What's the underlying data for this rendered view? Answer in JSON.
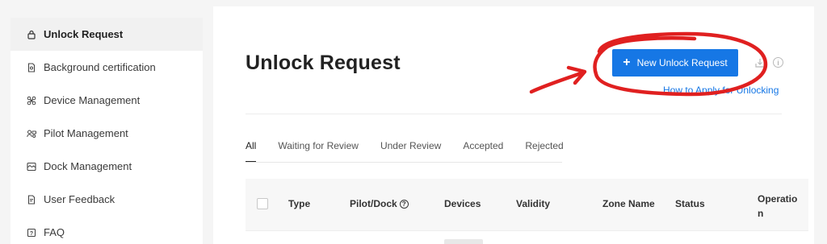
{
  "sidebar": {
    "items": [
      {
        "label": "Unlock Request",
        "icon": "lock-icon",
        "active": true
      },
      {
        "label": "Background certification",
        "icon": "document-icon",
        "active": false
      },
      {
        "label": "Device Management",
        "icon": "drone-icon",
        "active": false
      },
      {
        "label": "Pilot Management",
        "icon": "pilot-icon",
        "active": false
      },
      {
        "label": "Dock Management",
        "icon": "dock-icon",
        "active": false
      },
      {
        "label": "User Feedback",
        "icon": "feedback-icon",
        "active": false
      },
      {
        "label": "FAQ",
        "icon": "question-icon",
        "active": false
      }
    ]
  },
  "main": {
    "title": "Unlock Request",
    "new_button_label": "New Unlock Request",
    "help_link": "How to Apply for Unlocking",
    "tabs": [
      {
        "label": "All",
        "active": true
      },
      {
        "label": "Waiting for Review",
        "active": false
      },
      {
        "label": "Under Review",
        "active": false
      },
      {
        "label": "Accepted",
        "active": false
      },
      {
        "label": "Rejected",
        "active": false
      }
    ],
    "table": {
      "columns": {
        "type": "Type",
        "pilot_dock": "Pilot/Dock",
        "devices": "Devices",
        "validity": "Validity",
        "zone_name": "Zone Name",
        "status": "Status",
        "operation": "Operatio n"
      }
    }
  },
  "colors": {
    "accent": "#1677e5",
    "annotation": "#e02020"
  }
}
